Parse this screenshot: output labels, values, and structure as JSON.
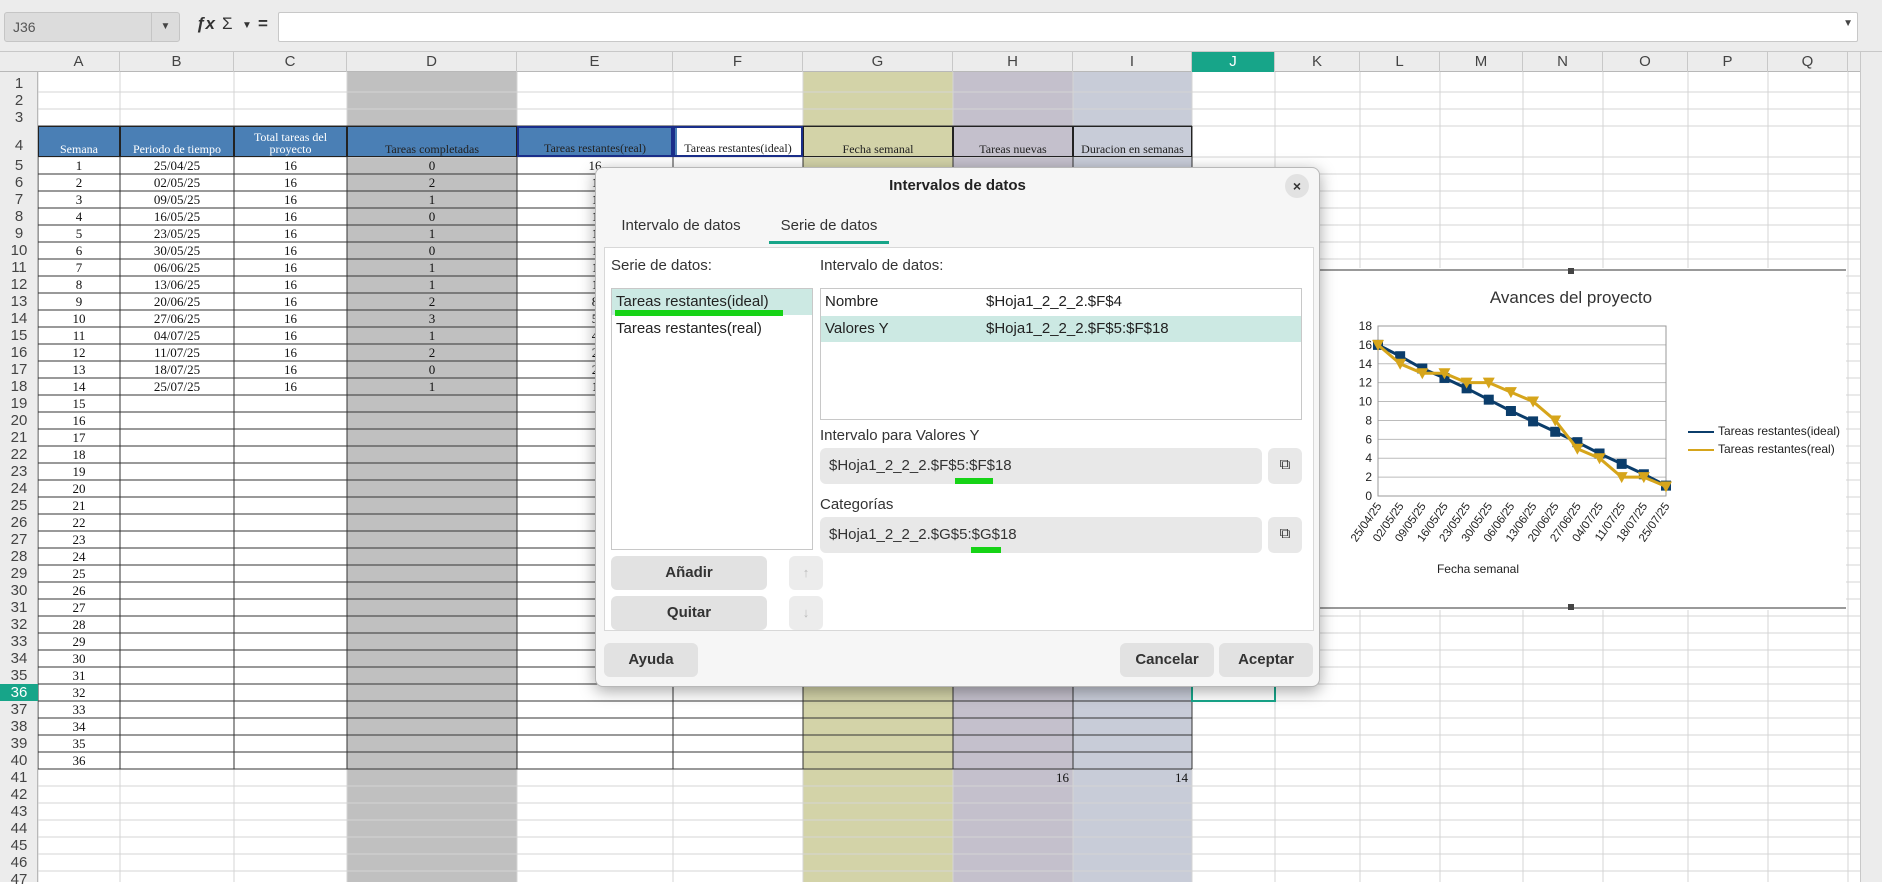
{
  "formula_bar": {
    "cell_ref": "J36",
    "fx": "ƒx",
    "sigma": "Σ",
    "eq": "="
  },
  "columns": [
    "A",
    "B",
    "C",
    "D",
    "E",
    "F",
    "G",
    "H",
    "I",
    "J",
    "K",
    "L",
    "M",
    "N",
    "O",
    "P",
    "Q"
  ],
  "rows": [
    "1",
    "2",
    "3",
    "4",
    "5",
    "6",
    "7",
    "8",
    "9",
    "10",
    "11",
    "12",
    "13",
    "14",
    "15",
    "16",
    "17",
    "18",
    "19",
    "20",
    "21",
    "22",
    "23",
    "24",
    "25",
    "26",
    "27",
    "28",
    "29",
    "30",
    "31",
    "32",
    "33",
    "34",
    "35",
    "36",
    "37",
    "38",
    "39",
    "40",
    "41",
    "42",
    "43",
    "44",
    "45",
    "46",
    "47"
  ],
  "selected_row": "36",
  "selected_col": "J",
  "headers": {
    "a": "Semana",
    "b": "Periodo de tiempo",
    "c": "Total tareas del proyecto",
    "d": "Tareas completadas",
    "e": "Tareas restantes(real)",
    "f": "Tareas restantes(ideal)",
    "g": "Fecha semanal",
    "h": "Tareas nuevas",
    "i": "Duracion en semanas"
  },
  "table": [
    [
      "1",
      "25/04/25",
      "16",
      "0",
      "16"
    ],
    [
      "2",
      "02/05/25",
      "16",
      "2",
      "1"
    ],
    [
      "3",
      "09/05/25",
      "16",
      "1",
      "1"
    ],
    [
      "4",
      "16/05/25",
      "16",
      "0",
      "1"
    ],
    [
      "5",
      "23/05/25",
      "16",
      "1",
      "1"
    ],
    [
      "6",
      "30/05/25",
      "16",
      "0",
      "1"
    ],
    [
      "7",
      "06/06/25",
      "16",
      "1",
      "1"
    ],
    [
      "8",
      "13/06/25",
      "16",
      "1",
      "1"
    ],
    [
      "9",
      "20/06/25",
      "16",
      "2",
      "8"
    ],
    [
      "10",
      "27/06/25",
      "16",
      "3",
      "5"
    ],
    [
      "11",
      "04/07/25",
      "16",
      "1",
      "4"
    ],
    [
      "12",
      "11/07/25",
      "16",
      "2",
      "2"
    ],
    [
      "13",
      "18/07/25",
      "16",
      "0",
      "2"
    ],
    [
      "14",
      "25/07/25",
      "16",
      "1",
      "1"
    ]
  ],
  "week_numbers_extra": [
    "15",
    "16",
    "17",
    "18",
    "19",
    "20",
    "21",
    "22",
    "23",
    "24",
    "25",
    "26",
    "27",
    "28",
    "29",
    "30",
    "31",
    "32",
    "33",
    "34",
    "35",
    "36"
  ],
  "row41": {
    "h": "16",
    "i": "14"
  },
  "chart_data": {
    "type": "line",
    "title": "Avances del proyecto",
    "xlabel": "Fecha semanal",
    "ylabel": "",
    "categories": [
      "25/04/25",
      "02/05/25",
      "09/05/25",
      "16/05/25",
      "23/05/25",
      "30/05/25",
      "06/06/25",
      "13/06/25",
      "20/06/25",
      "27/06/25",
      "04/07/25",
      "11/07/25",
      "18/07/25",
      "25/07/25"
    ],
    "ylim": [
      0,
      18
    ],
    "yticks": [
      0,
      2,
      4,
      6,
      8,
      10,
      12,
      14,
      16,
      18
    ],
    "series": [
      {
        "name": "Tareas restantes(ideal)",
        "color": "#0b3d6b",
        "marker": "square",
        "values": [
          16,
          14.8,
          13.5,
          12.5,
          11.4,
          10.2,
          9,
          7.9,
          6.8,
          5.7,
          4.5,
          3.4,
          2.3,
          1.1
        ]
      },
      {
        "name": "Tareas restantes(real)",
        "color": "#d6a51b",
        "marker": "triangle",
        "values": [
          16,
          14,
          13,
          13,
          12,
          12,
          11,
          10,
          8,
          5,
          4,
          2,
          2,
          1
        ]
      }
    ],
    "legend": "right"
  },
  "dialog": {
    "title": "Intervalos de datos",
    "close": "×",
    "tab1": "Intervalo de datos",
    "tab2": "Serie de datos",
    "series_label": "Serie de datos:",
    "series": [
      "Tareas restantes(ideal)",
      "Tareas restantes(real)"
    ],
    "ranges_label": "Intervalo de datos:",
    "ranges": [
      {
        "k": "Nombre",
        "v": "$Hoja1_2_2_2.$F$4"
      },
      {
        "k": "Valores Y",
        "v": "$Hoja1_2_2_2.$F$5:$F$18"
      }
    ],
    "y_label": "Intervalo para Valores Y",
    "y_value": "$Hoja1_2_2_2.$F$5:$F$18",
    "cat_label": "Categorías",
    "cat_value": "$Hoja1_2_2_2.$G$5:$G$18",
    "add": "Añadir",
    "remove": "Quitar",
    "up": "↑",
    "down": "↓",
    "help": "Ayuda",
    "cancel": "Cancelar",
    "ok": "Aceptar"
  }
}
